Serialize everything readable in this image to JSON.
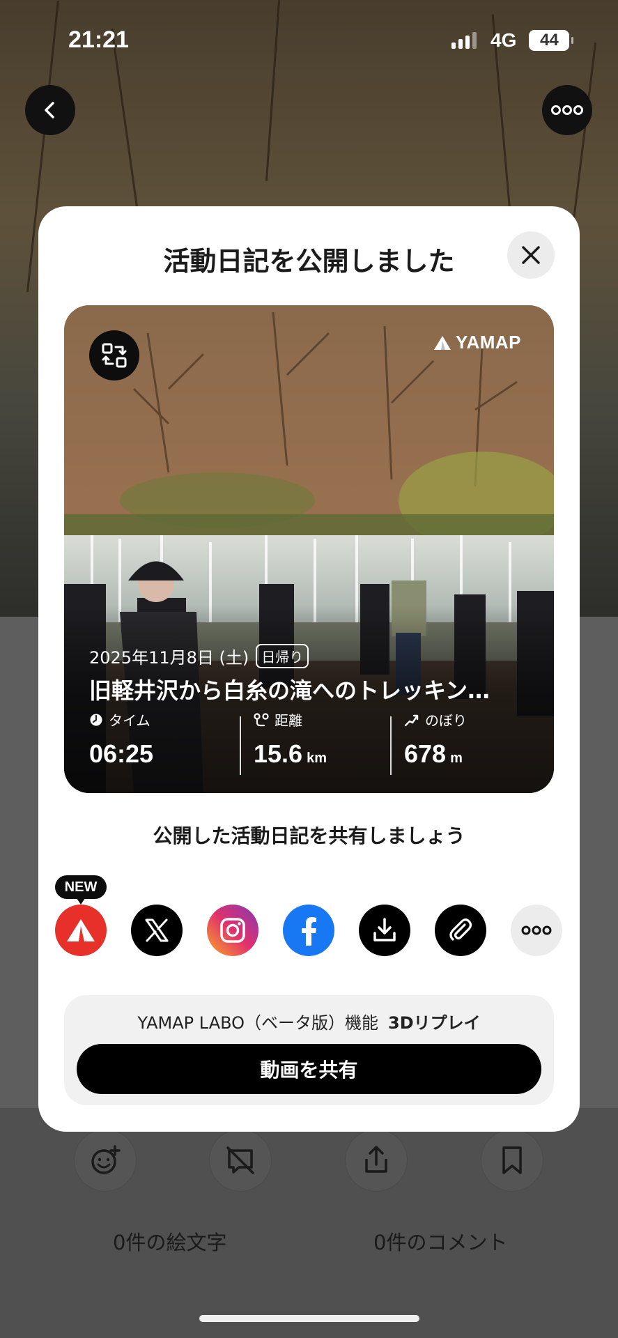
{
  "status_bar": {
    "time": "21:21",
    "network": "4G",
    "battery": "44"
  },
  "background": {
    "back_icon": "chevron-left-icon",
    "more_icon": "more-horizontal-icon",
    "bottom_actions": [
      "add-emoji-icon",
      "comment-off-icon",
      "share-icon",
      "bookmark-icon"
    ],
    "emoji_count": "0件の絵文字",
    "comment_count": "0件のコメント"
  },
  "modal": {
    "title": "活動日記を公開しました",
    "close_icon": "close-icon",
    "card": {
      "brand": "YAMAP",
      "swap_icon": "swap-icon",
      "date": "2025年11月8日 (土)",
      "badge": "日帰り",
      "title": "旧軽井沢から白糸の滝へのトレッキン…",
      "stats": [
        {
          "icon": "clock-icon",
          "label": "タイム",
          "value": "06:25",
          "unit": ""
        },
        {
          "icon": "route-icon",
          "label": "距離",
          "value": "15.6",
          "unit": "km"
        },
        {
          "icon": "ascent-icon",
          "label": "のぼり",
          "value": "678",
          "unit": "m"
        }
      ]
    },
    "share_prompt": "公開した活動日記を共有しましょう",
    "new_badge": "NEW",
    "share_targets": [
      {
        "name": "yamap-share",
        "icon": "yamap-icon",
        "color": "#e8302a"
      },
      {
        "name": "x-share",
        "icon": "x-icon",
        "color": "#000000"
      },
      {
        "name": "instagram-share",
        "icon": "instagram-icon",
        "color": "#d62976"
      },
      {
        "name": "facebook-share",
        "icon": "facebook-icon",
        "color": "#1877f2"
      },
      {
        "name": "download-share",
        "icon": "download-icon",
        "color": "#000000"
      },
      {
        "name": "link-share",
        "icon": "paperclip-icon",
        "color": "#000000"
      },
      {
        "name": "more-share",
        "icon": "more-horizontal-icon",
        "color": "#ececec"
      }
    ],
    "labo": {
      "label": "YAMAP LABO（ベータ版）機能",
      "feature": "3Dリプレイ",
      "button": "動画を共有"
    }
  }
}
